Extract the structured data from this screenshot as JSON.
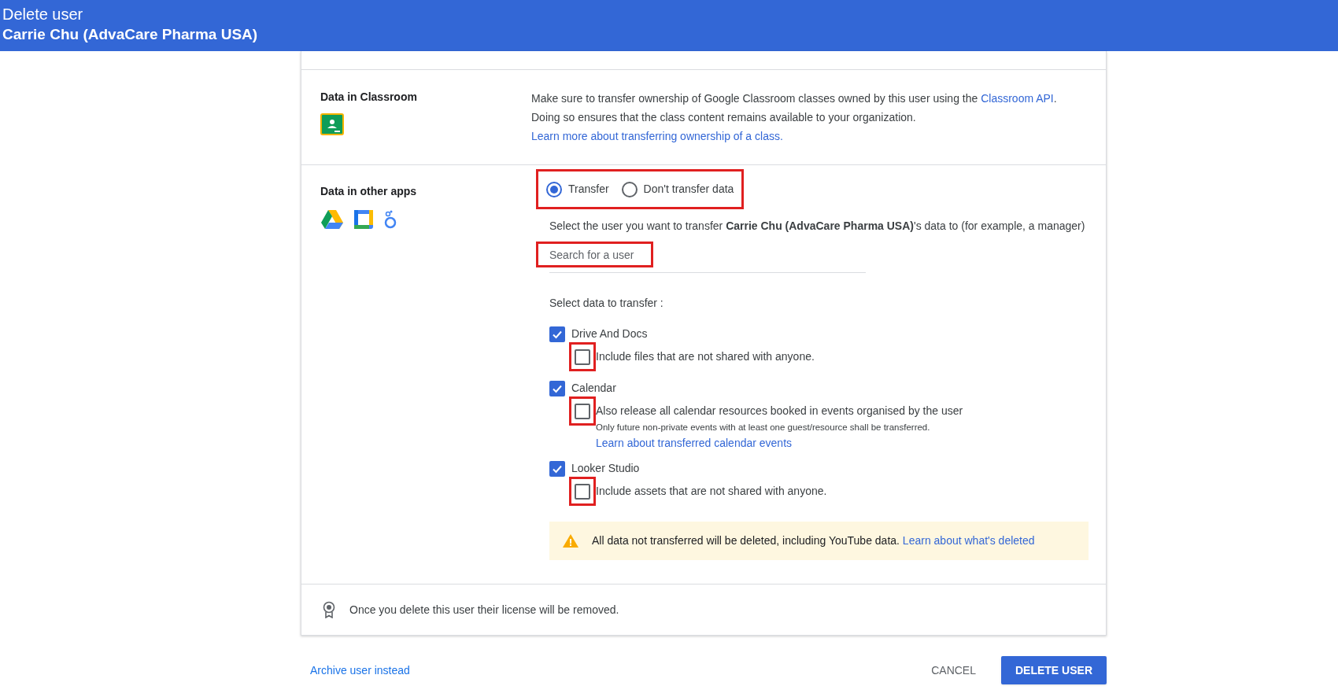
{
  "header": {
    "title": "Delete user",
    "subtitle": "Carrie Chu (AdvaCare Pharma USA)"
  },
  "classroom": {
    "label": "Data in Classroom",
    "text": [
      {
        "text": "Make sure to transfer ownership of Google Classroom classes owned by this user using the ",
        "link": false
      },
      {
        "text": "Classroom API",
        "link": true
      },
      {
        "text": ". Doing so ensures that the class content remains available to your organization. ",
        "link": false
      },
      {
        "text": "Learn more about transferring ownership of a class.",
        "link": true
      }
    ]
  },
  "other_apps": {
    "label": "Data in other apps",
    "radios_highlighted": true,
    "radios": [
      {
        "label": "Transfer",
        "selected": true
      },
      {
        "label": "Don't transfer data",
        "selected": false
      }
    ],
    "prompt": "Select the user you want to transfer **Carrie Chu (AdvaCare Pharma USA)**'s data to (for example, a manager)",
    "search": {
      "placeholder": "Search for a user",
      "highlighted": true
    },
    "data_heading": "Select data to transfer :",
    "items": [
      {
        "label": "Drive And Docs",
        "checked": true,
        "option": {
          "label": "Include files that are not shared with anyone.",
          "checked": false,
          "highlighted": true
        }
      },
      {
        "label": "Calendar",
        "checked": true,
        "option": {
          "label": "Also release all calendar resources booked in events organised by the user",
          "checked": false,
          "highlighted": true,
          "note": "Only future non-private events with at least one guest/resource shall be transferred.",
          "link": "Learn about transferred calendar events"
        }
      },
      {
        "label": "Looker Studio",
        "checked": true,
        "option": {
          "label": "Include assets that are not shared with anyone.",
          "checked": false,
          "highlighted": true
        }
      }
    ],
    "warning": {
      "text": "All data not transferred will be deleted, including YouTube data.",
      "link": "Learn about what's deleted"
    }
  },
  "license": "Once you delete this user their license will be removed.",
  "footer": {
    "archive": "Archive user instead",
    "cancel": "CANCEL",
    "delete": "DELETE USER"
  }
}
